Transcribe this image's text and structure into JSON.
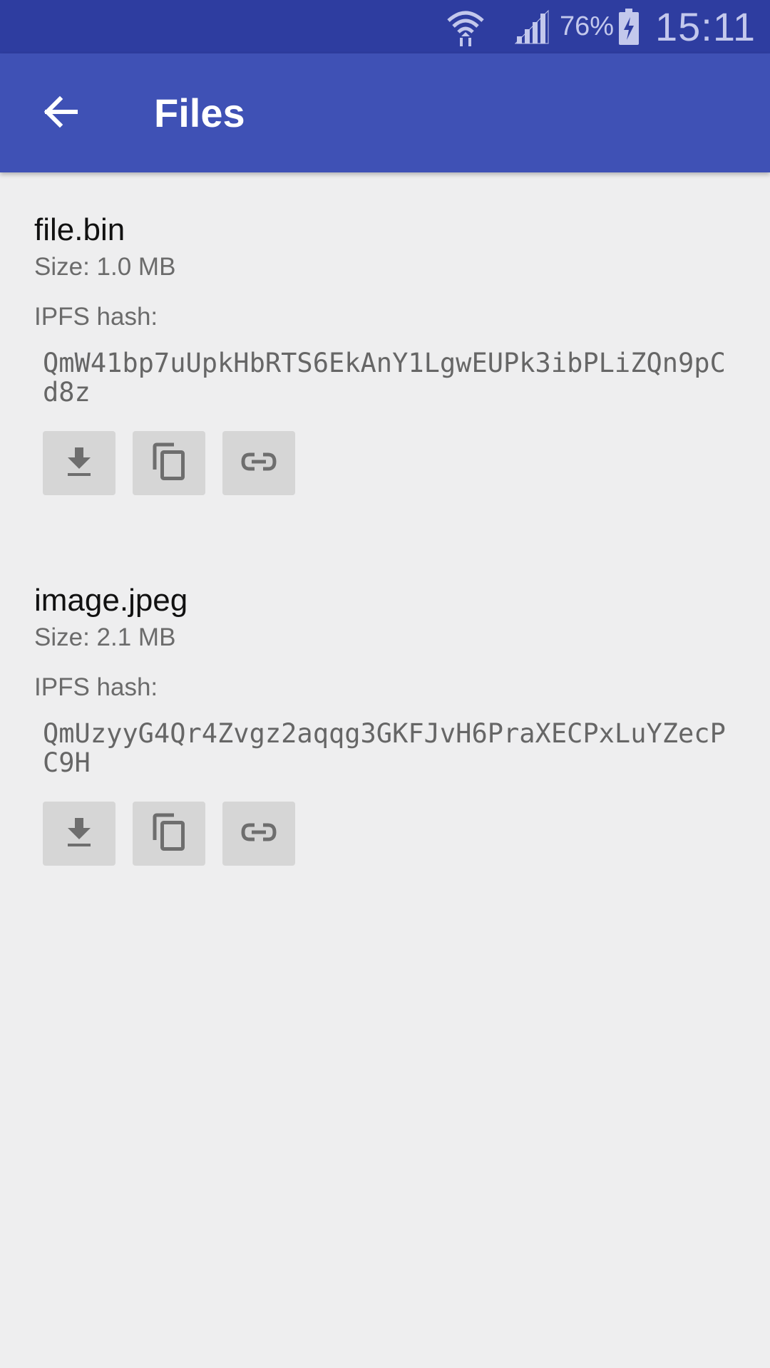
{
  "status_bar": {
    "battery": "76%",
    "time": "15:11",
    "icons": [
      "wifi-icon",
      "signal-icon",
      "battery-charging-icon"
    ]
  },
  "app_bar": {
    "title": "Files",
    "back_icon": "arrow-back-icon"
  },
  "files": [
    {
      "name": "file.bin",
      "size": "Size: 1.0 MB",
      "hash_label": "IPFS hash:",
      "hash": "QmW41bp7uUpkHbRTS6EkAnY1LgwEUPk3ibPLiZQn9pCd8z",
      "actions": [
        "download-icon",
        "copy-icon",
        "link-icon"
      ]
    },
    {
      "name": "image.jpeg",
      "size": "Size: 2.1 MB",
      "hash_label": "IPFS hash:",
      "hash": "QmUzyyG4Qr4Zvgz2aqqg3GKFJvH6PraXECPxLuYZecPC9H",
      "actions": [
        "download-icon",
        "copy-icon",
        "link-icon"
      ]
    }
  ],
  "colors": {
    "status_bar": "#2e3da0",
    "app_bar": "#3f51b5",
    "background": "#eeeeef",
    "button": "#d6d6d6",
    "icon": "#6e6e6e"
  }
}
